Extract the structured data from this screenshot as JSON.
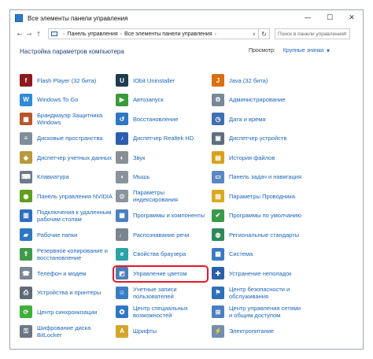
{
  "window": {
    "title": "Все элементы панели управления",
    "controls": {
      "minimize": "—",
      "maximize": "☐",
      "close": "✕"
    }
  },
  "nav": {
    "back": "←",
    "forward": "→",
    "up": "↑"
  },
  "address": {
    "crumbs": [
      "Панель управления",
      "Все элементы панели управления"
    ],
    "dropdown": "∨",
    "refresh": "↻"
  },
  "search": {
    "placeholder": "Поиск в панели управления"
  },
  "header": {
    "title": "Настройка параметров компьютера",
    "view_label": "Просмотр:",
    "view_value": "Крупные значки"
  },
  "items": [
    {
      "label": "Flash Player (32 бита)",
      "icon": "flash-icon",
      "color": "#8b1a1a",
      "glyph": "f"
    },
    {
      "label": "IObit Uninstaller",
      "icon": "uninstaller-icon",
      "color": "#1d3b4f",
      "glyph": "U"
    },
    {
      "label": "Java (32 бита)",
      "icon": "java-icon",
      "color": "#d96f10",
      "glyph": "J"
    },
    {
      "label": "Windows To Go",
      "icon": "windows-to-go-icon",
      "color": "#2e8bd8",
      "glyph": "W"
    },
    {
      "label": "Автозапуск",
      "icon": "autoplay-icon",
      "color": "#3a9a3a",
      "glyph": "▶"
    },
    {
      "label": "Администрирование",
      "icon": "admin-tools-icon",
      "color": "#7a8896",
      "glyph": "⚙"
    },
    {
      "label": "Брандмауэр Защитника Windows",
      "icon": "firewall-icon",
      "color": "#b8562a",
      "glyph": "▦"
    },
    {
      "label": "Восстановление",
      "icon": "recovery-icon",
      "color": "#2f77c4",
      "glyph": "↺"
    },
    {
      "label": "Дата и время",
      "icon": "clock-icon",
      "color": "#3f6fb0",
      "glyph": "◷"
    },
    {
      "label": "Дисковые пространства",
      "icon": "storage-spaces-icon",
      "color": "#7f8c99",
      "glyph": "≡"
    },
    {
      "label": "Диспетчер Realtek HD",
      "icon": "realtek-icon",
      "color": "#2b5db0",
      "glyph": "♪"
    },
    {
      "label": "Диспетчер устройств",
      "icon": "device-manager-icon",
      "color": "#5f6f80",
      "glyph": "▣"
    },
    {
      "label": "Диспетчер учетных данных",
      "icon": "credential-manager-icon",
      "color": "#b89a3a",
      "glyph": "◈"
    },
    {
      "label": "Звук",
      "icon": "sound-icon",
      "color": "#8a8f96",
      "glyph": "◐"
    },
    {
      "label": "История файлов",
      "icon": "file-history-icon",
      "color": "#d6a21e",
      "glyph": "▤"
    },
    {
      "label": "Клавиатура",
      "icon": "keyboard-icon",
      "color": "#6e7a86",
      "glyph": "⌨"
    },
    {
      "label": "Мышь",
      "icon": "mouse-icon",
      "color": "#8a939c",
      "glyph": "◖"
    },
    {
      "label": "Панель задач и навигация",
      "icon": "taskbar-icon",
      "color": "#5a87c2",
      "glyph": "▭"
    },
    {
      "label": "Панель управления NVIDIA",
      "icon": "nvidia-icon",
      "color": "#5f9e1e",
      "glyph": "◉"
    },
    {
      "label": "Параметры индексирования",
      "icon": "indexing-icon",
      "color": "#8a949f",
      "glyph": "⊙"
    },
    {
      "label": "Параметры Проводника",
      "icon": "explorer-options-icon",
      "color": "#d9a923",
      "glyph": "▧"
    },
    {
      "label": "Подключения к удаленным рабочим столам",
      "icon": "remote-desktop-icon",
      "color": "#2e6fbf",
      "glyph": "▥"
    },
    {
      "label": "Программы и компоненты",
      "icon": "programs-icon",
      "color": "#4b7fc0",
      "glyph": "▦"
    },
    {
      "label": "Программы по умолчанию",
      "icon": "default-programs-icon",
      "color": "#3a9a4a",
      "glyph": "✔"
    },
    {
      "label": "Рабочие папки",
      "icon": "work-folders-icon",
      "color": "#2f77c4",
      "glyph": "▰"
    },
    {
      "label": "Распознавание речи",
      "icon": "microphone-icon",
      "color": "#7a8590",
      "glyph": "♩"
    },
    {
      "label": "Региональные стандарты",
      "icon": "region-icon",
      "color": "#2f8a5a",
      "glyph": "◍"
    },
    {
      "label": "Резервное копирование и восстановление",
      "icon": "backup-icon",
      "color": "#3f9a4a",
      "glyph": "⇪"
    },
    {
      "label": "Свойства браузера",
      "icon": "internet-options-icon",
      "color": "#2aa3a8",
      "glyph": "e"
    },
    {
      "label": "Система",
      "icon": "system-icon",
      "color": "#3a7bc4",
      "glyph": "▩"
    },
    {
      "label": "Телефон и модем",
      "icon": "phone-modem-icon",
      "color": "#7a8793",
      "glyph": "☎"
    },
    {
      "label": "Управление цветом",
      "icon": "color-management-icon",
      "color": "#4c7fb8",
      "glyph": "◩"
    },
    {
      "label": "Устранение неполадок",
      "icon": "troubleshooting-icon",
      "color": "#2b5fa8",
      "glyph": "✚"
    },
    {
      "label": "Устройства и принтеры",
      "icon": "printer-icon",
      "color": "#5e6a76",
      "glyph": "⎙"
    },
    {
      "label": "Учетные записи пользователей",
      "icon": "user-accounts-icon",
      "color": "#3b7dc4",
      "glyph": "☺"
    },
    {
      "label": "Центр безопасности и обслуживания",
      "icon": "security-flag-icon",
      "color": "#2f6fb8",
      "glyph": "⚑"
    },
    {
      "label": "Центр синхронизации",
      "icon": "sync-center-icon",
      "color": "#3fae3a",
      "glyph": "⟳"
    },
    {
      "label": "Центр специальных возможностей",
      "icon": "accessibility-icon",
      "color": "#2f77c4",
      "glyph": "✪"
    },
    {
      "label": "Центр управления сетями и общим доступом",
      "icon": "network-icon",
      "color": "#4a80c0",
      "glyph": "⊞"
    },
    {
      "label": "Шифрование диска BitLocker",
      "icon": "bitlocker-icon",
      "color": "#6b7784",
      "glyph": "⚿"
    },
    {
      "label": "Шрифты",
      "icon": "fonts-icon",
      "color": "#d4a52a",
      "glyph": "A"
    },
    {
      "label": "Электропитание",
      "icon": "power-options-icon",
      "color": "#6f8fb0",
      "glyph": "⚡"
    }
  ]
}
